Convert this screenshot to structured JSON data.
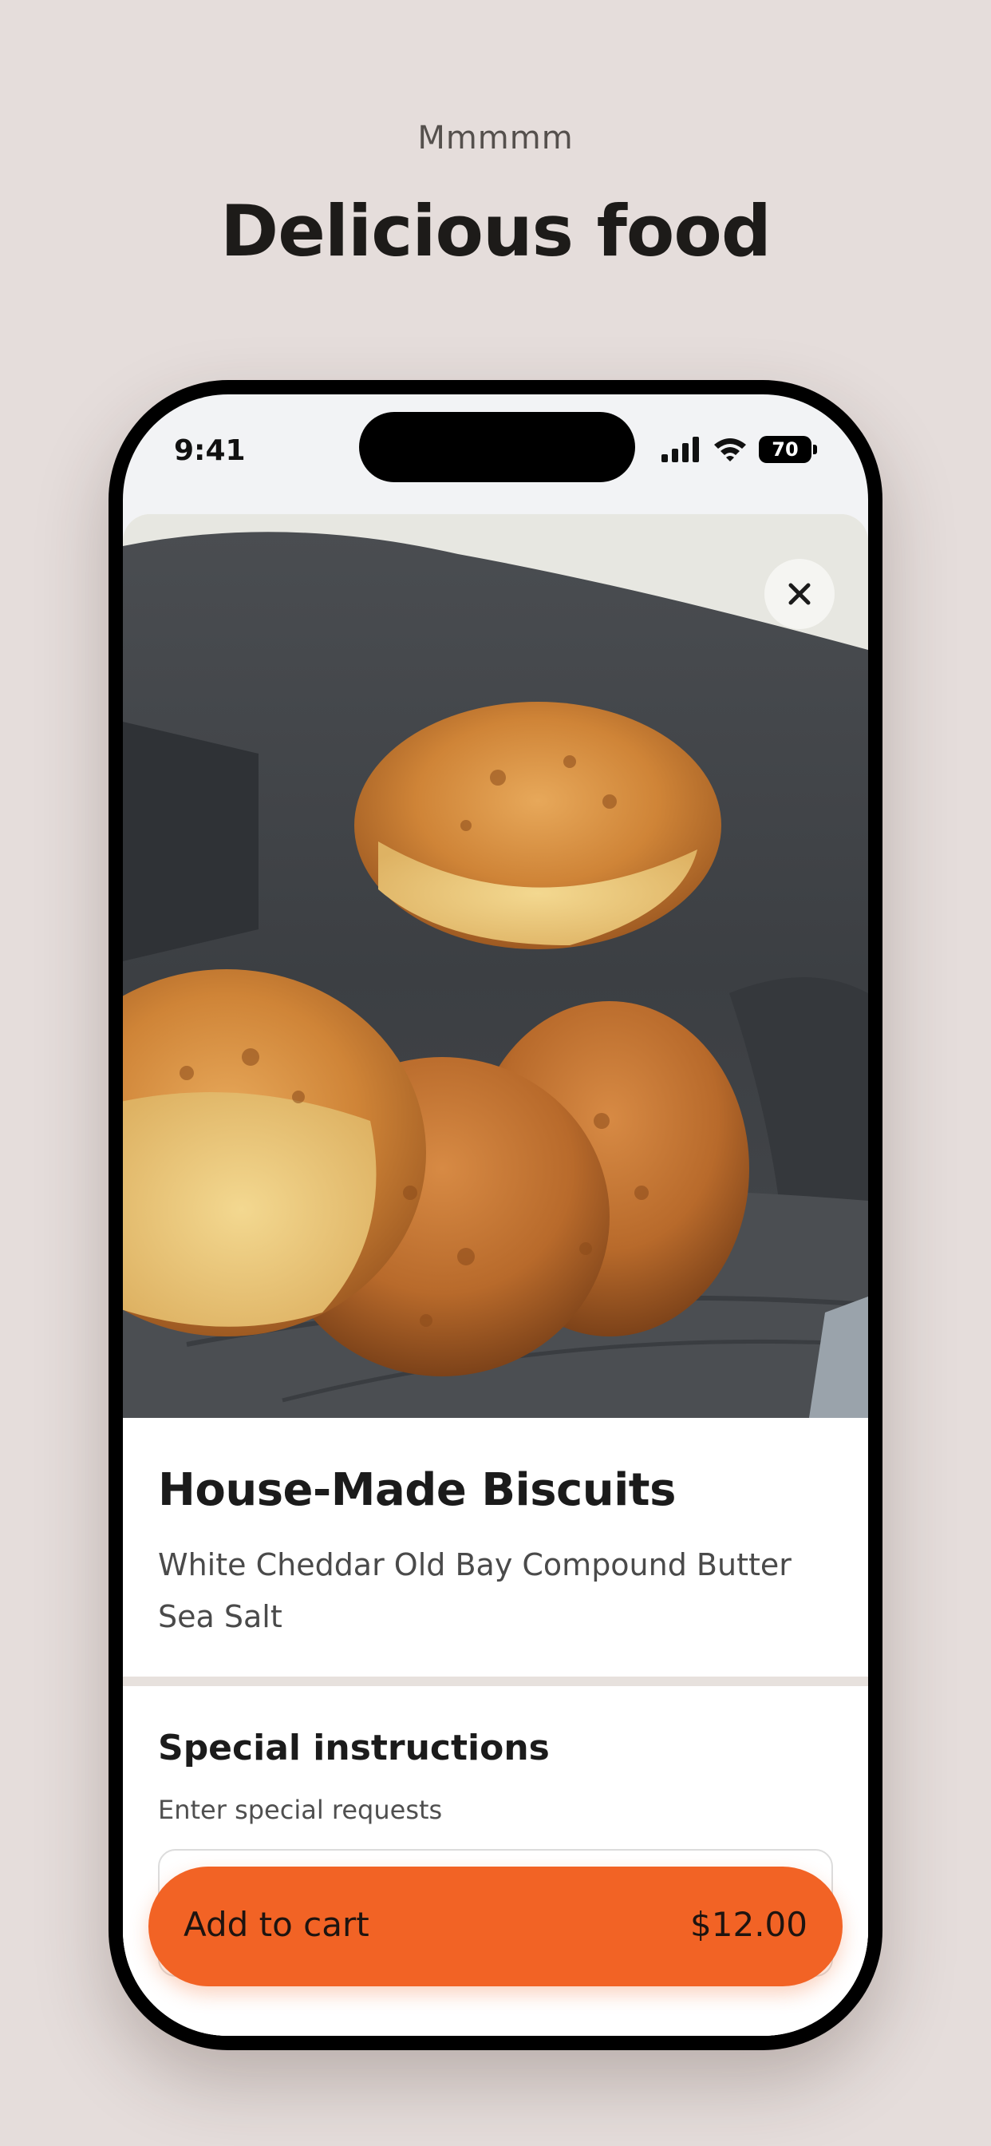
{
  "promo": {
    "kicker": "Mmmmm",
    "title": "Delicious food"
  },
  "status_bar": {
    "time": "9:41",
    "battery": "70",
    "icons": [
      "signal-icon",
      "wifi-icon",
      "battery-icon"
    ]
  },
  "item": {
    "image_alt": "Biscuits in a dark napkin-lined basket",
    "title": "House-Made Biscuits",
    "description": "White Cheddar Old Bay Compound Butter Sea Salt"
  },
  "instructions": {
    "title": "Special instructions",
    "hint": "Enter special requests"
  },
  "cart_button": {
    "label": "Add to cart",
    "price": "$12.00"
  },
  "colors": {
    "background": "#e5dddb",
    "accent": "#f26325",
    "divider": "#e7e1dd"
  }
}
